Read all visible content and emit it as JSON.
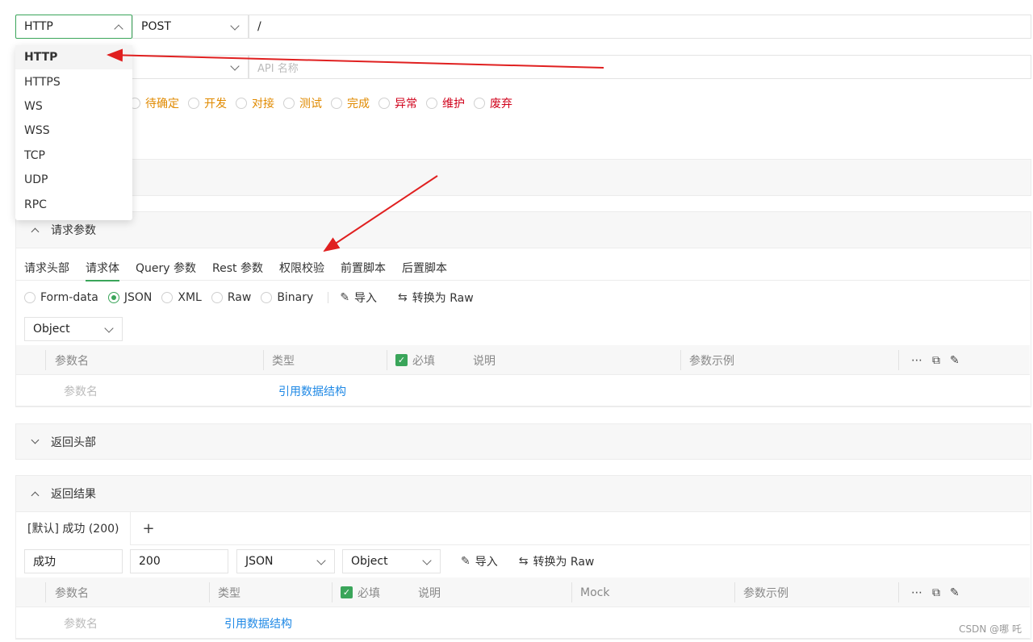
{
  "request": {
    "protocol": "HTTP",
    "method": "POST",
    "path": "/",
    "name_placeholder": "API 名称"
  },
  "protocol_options": [
    "HTTP",
    "HTTPS",
    "WS",
    "WSS",
    "TCP",
    "UDP",
    "RPC"
  ],
  "status_options": [
    {
      "label": "待确定",
      "color": "#e08a00"
    },
    {
      "label": "开发",
      "color": "#e08a00"
    },
    {
      "label": "对接",
      "color": "#e08a00"
    },
    {
      "label": "测试",
      "color": "#e08a00"
    },
    {
      "label": "完成",
      "color": "#e08a00"
    },
    {
      "label": "异常",
      "color": "#d0021b"
    },
    {
      "label": "维护",
      "color": "#d0021b"
    },
    {
      "label": "废弃",
      "color": "#d0021b"
    }
  ],
  "request_params": {
    "title": "请求参数",
    "tabs": [
      "请求头部",
      "请求体",
      "Query 参数",
      "Rest 参数",
      "权限校验",
      "前置脚本",
      "后置脚本"
    ],
    "active_tab": "请求体",
    "body_types": [
      "Form-data",
      "JSON",
      "XML",
      "Raw",
      "Binary"
    ],
    "selected_body_type": "JSON",
    "import_label": "导入",
    "convert_label": "转换为 Raw",
    "root_type": "Object",
    "columns": {
      "name": "参数名",
      "type": "类型",
      "required": "必填",
      "desc": "说明",
      "example": "参数示例"
    },
    "row": {
      "name_placeholder": "参数名",
      "ref_link": "引用数据结构"
    }
  },
  "response_headers": {
    "title": "返回头部"
  },
  "response_result": {
    "title": "返回结果",
    "tab_label": "[默认] 成功 (200)",
    "add_label": "+",
    "name": "成功",
    "code": "200",
    "format": "JSON",
    "root_type": "Object",
    "import_label": "导入",
    "convert_label": "转换为 Raw",
    "columns": {
      "name": "参数名",
      "type": "类型",
      "required": "必填",
      "desc": "说明",
      "mock": "Mock",
      "example": "参数示例"
    },
    "row": {
      "name_placeholder": "参数名",
      "ref_link": "引用数据结构"
    }
  },
  "icons": {
    "more": "⋯",
    "copy": "⧉",
    "edit": "✎",
    "convert": "⇆",
    "check": "✓"
  },
  "watermark": "CSDN @哪 吒",
  "accent_color": "#3aa55a",
  "arrow_color": "#e02020"
}
